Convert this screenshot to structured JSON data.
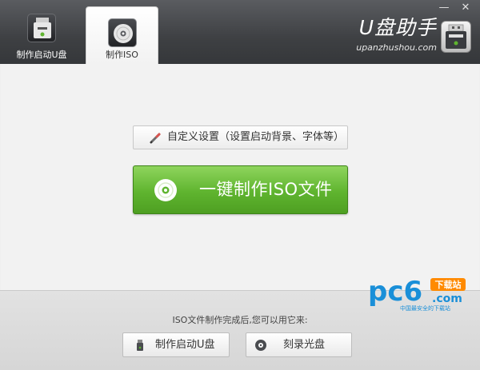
{
  "window": {
    "minimize_glyph": "—",
    "close_glyph": "✕"
  },
  "tabs": [
    {
      "label": "制作启动U盘",
      "icon": "usb-drive-icon",
      "active": false
    },
    {
      "label": "制作ISO",
      "icon": "disc-icon",
      "active": true
    }
  ],
  "brand": {
    "name": "U盘助手",
    "domain": "upanzhushou.com",
    "icon": "usb-drive-icon"
  },
  "main": {
    "custom_settings_label": "自定义设置（设置启动背景、字体等）",
    "custom_settings_icon": "brush-icon",
    "make_iso_label": "一键制作ISO文件",
    "make_iso_icon": "disc-icon"
  },
  "footer": {
    "hint": "ISO文件制作完成后,您可以用它来:",
    "usb_button_label": "制作启动U盘",
    "usb_button_icon": "usb-drive-icon",
    "burn_button_label": "刻录光盘",
    "burn_button_icon": "disc-icon"
  },
  "watermark": {
    "logo": "pc6",
    "badge": "下载站",
    "domain": ".com",
    "slogan": "中国最安全的下载站"
  },
  "colors": {
    "header": "#3e4043",
    "accent_green": "#5fb42f",
    "watermark_blue": "#1a8fd8",
    "watermark_orange": "#ff8a00"
  }
}
